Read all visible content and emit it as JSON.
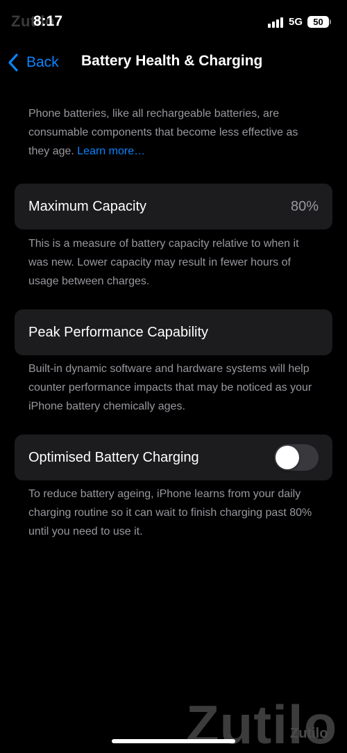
{
  "status_bar": {
    "time": "8:17",
    "network": "5G",
    "battery_level": "50",
    "watermark": "Zutilo"
  },
  "nav": {
    "back_label": "Back",
    "title": "Battery Health & Charging"
  },
  "intro": {
    "text": "Phone batteries, like all rechargeable batteries, are consumable components that become less effective as they age. ",
    "link": "Learn more…"
  },
  "maximum_capacity": {
    "label": "Maximum Capacity",
    "value": "80%",
    "footer": "This is a measure of battery capacity relative to when it was new. Lower capacity may result in fewer hours of usage between charges."
  },
  "peak_performance": {
    "label": "Peak Performance Capability",
    "footer": "Built-in dynamic software and hardware systems will help counter performance impacts that may be noticed as your iPhone battery chemically ages."
  },
  "optimised_charging": {
    "label": "Optimised Battery Charging",
    "enabled": false,
    "footer": "To reduce battery ageing, iPhone learns from your daily charging routine so it can wait to finish charging past 80% until you need to use it."
  },
  "watermark": {
    "large": "Zutilo",
    "small": "Zutilo"
  },
  "colors": {
    "background": "#000000",
    "cell_background": "#1c1c1e",
    "accent_blue": "#0a84ff",
    "secondary_text": "#98989f",
    "toggle_off": "#39393d"
  },
  "icons": {
    "back": "chevron-left-icon",
    "signal": "cellular-signal-icon",
    "battery": "battery-icon"
  }
}
